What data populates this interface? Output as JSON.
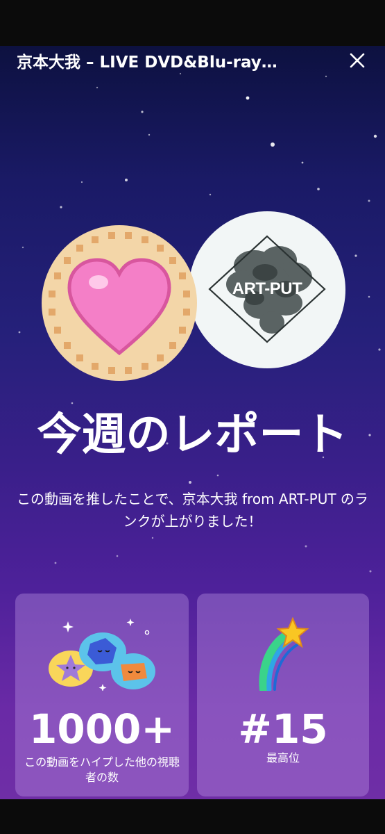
{
  "header": {
    "title": "京本大我 – LIVE DVD&Blu-ray…",
    "close_icon": "close-icon"
  },
  "avatars": {
    "left_icon": "heart-cookie-icon",
    "right_label": "ART-PUT"
  },
  "report": {
    "title": "今週のレポート",
    "description": "この動画を推したことで、京本大我 from ART-PUT のランクが上がりました！"
  },
  "stats": {
    "viewers": {
      "value": "1000+",
      "label": "この動画をハイプした他の視聴者の数",
      "icon": "hype-friends-icon"
    },
    "rank": {
      "value": "#15",
      "label": "最高位",
      "icon": "shooting-star-icon"
    }
  },
  "colors": {
    "background_top": "#0d1140",
    "background_bottom": "#6f2ea6",
    "card": "#a27fd0",
    "cookie": "#f3d6a8",
    "heart": "#f47fc7"
  }
}
